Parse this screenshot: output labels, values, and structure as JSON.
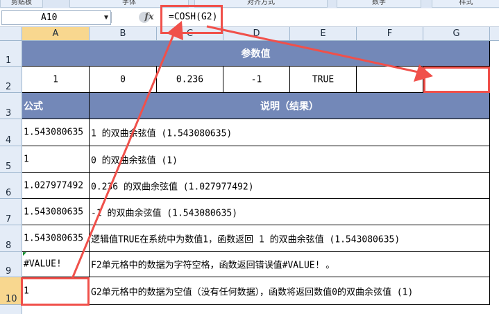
{
  "ribbon": {
    "groups": [
      "剪贴板",
      "字体",
      "对齐方式",
      "数字",
      "样式"
    ]
  },
  "formula_bar": {
    "name_box": "A10",
    "fx_label": "fx",
    "formula": "=COSH(G2)"
  },
  "columns": [
    "A",
    "B",
    "C",
    "D",
    "E",
    "F",
    "G"
  ],
  "rows": [
    "1",
    "2",
    "3",
    "4",
    "5",
    "6",
    "7",
    "8",
    "9",
    "10"
  ],
  "sheet": {
    "title": "参数值",
    "params": [
      "1",
      "0",
      "0.236",
      "-1",
      "TRUE",
      "",
      ""
    ],
    "formula_header": "公式",
    "desc_header": "说明（结果）",
    "results": [
      {
        "value": "1.543080635",
        "desc": " 1 的双曲余弦值 (1.543080635)"
      },
      {
        "value": "1",
        "desc": " 0 的双曲余弦值 (1)"
      },
      {
        "value": "1.027977492",
        "desc": " 0.236 的双曲余弦值 (1.027977492)"
      },
      {
        "value": "1.543080635",
        "desc": " -1 的双曲余弦值 (1.543080635)"
      },
      {
        "value": "1.543080635",
        "desc": "逻辑值TRUE在系统中为数值1，函数返回 1 的双曲余弦值 (1.543080635)"
      },
      {
        "value": "#VALUE!",
        "desc": "F2单元格中的数据为字符空格，函数返回错误值#VALUE! 。"
      },
      {
        "value": "1",
        "desc": "G2单元格中的数据为空值（没有任何数据），函数将返回数值0的双曲余弦值 (1)"
      }
    ]
  },
  "colors": {
    "header_bg": "#7388b8",
    "annotation_red": "#f0504a",
    "selected_header": "#f8d78f"
  }
}
